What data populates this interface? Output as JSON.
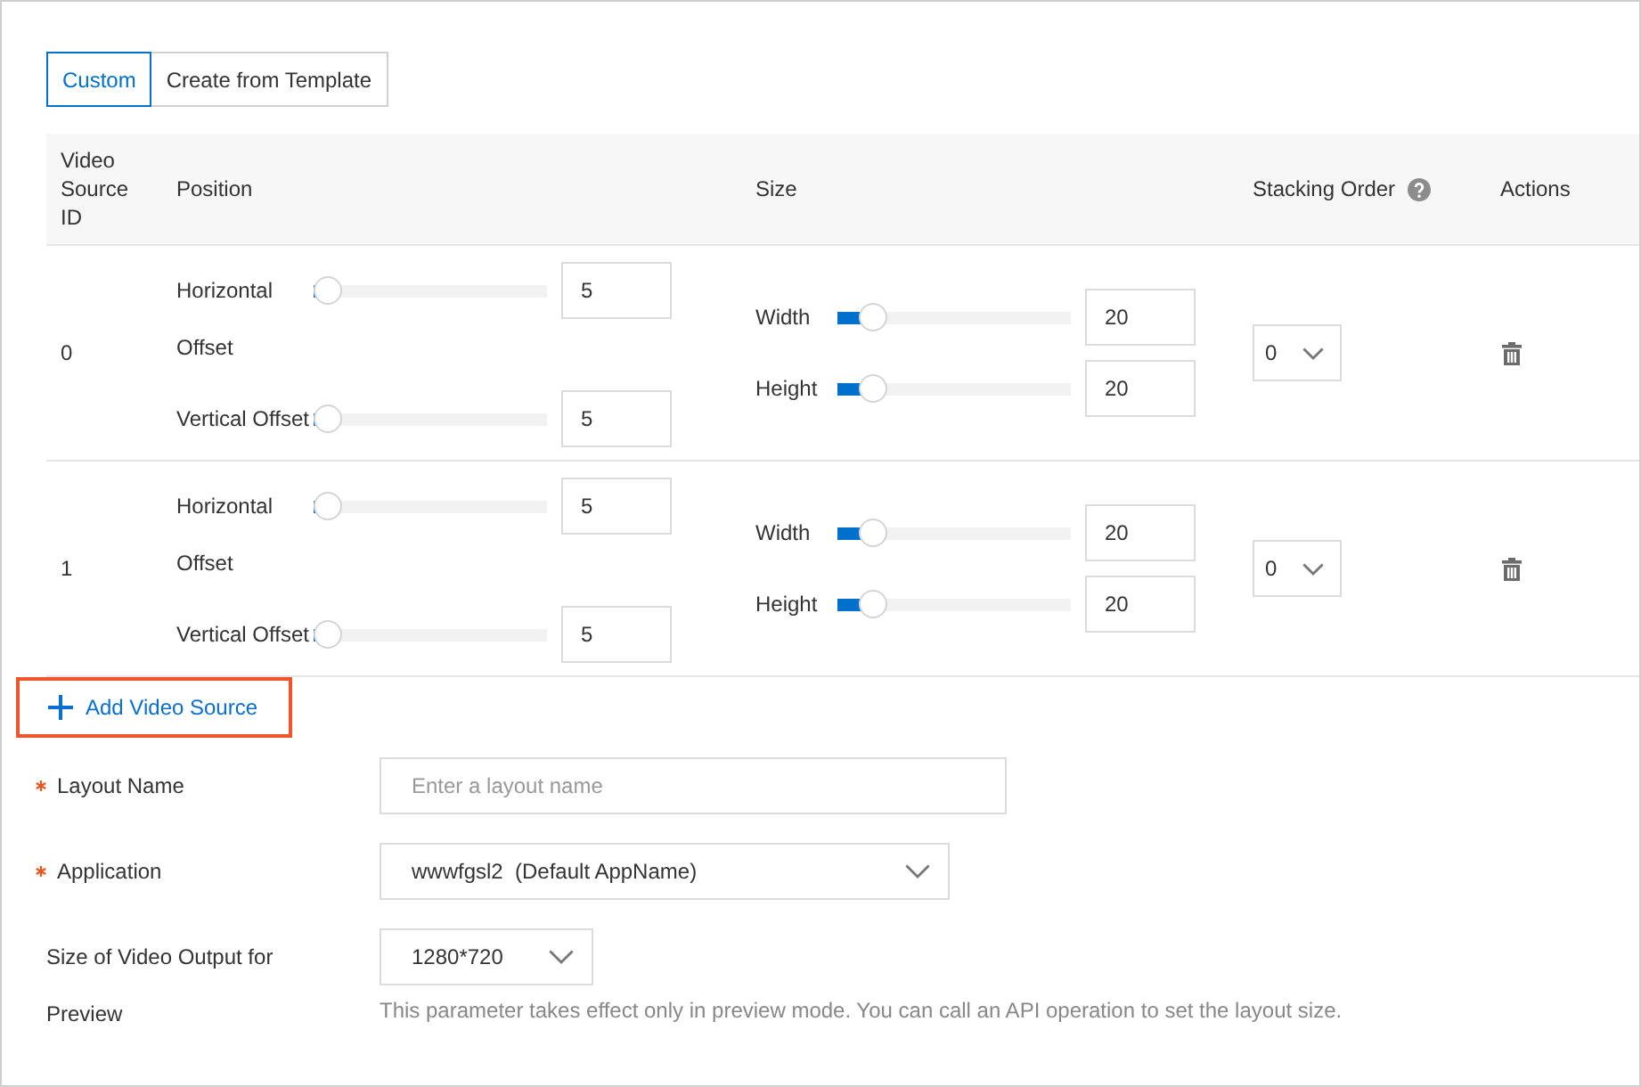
{
  "tabs": [
    {
      "label": "Custom",
      "selected": true
    },
    {
      "label": "Create from Template",
      "selected": false
    }
  ],
  "table": {
    "columns": [
      {
        "label": "Video Source ID",
        "help_icon": false
      },
      {
        "label": "Position",
        "help_icon": false
      },
      {
        "label": "Size",
        "help_icon": false
      },
      {
        "label": "Stacking Order",
        "help_icon": true
      },
      {
        "label": "Actions",
        "help_icon": false
      }
    ],
    "rows": [
      {
        "id": "0",
        "position": [
          {
            "label": "Horizontal Offset",
            "level": 0,
            "value": "5"
          },
          {
            "label": "Vertical Offset",
            "level": 0,
            "value": "5"
          }
        ],
        "size": [
          {
            "label": "Width",
            "level": 0.1,
            "value": "20"
          },
          {
            "label": "Height",
            "level": 0.1,
            "value": "20"
          }
        ],
        "stacking_order": "0"
      },
      {
        "id": "1",
        "position": [
          {
            "label": "Horizontal Offset",
            "level": 0,
            "value": "5"
          },
          {
            "label": "Vertical Offset",
            "level": 0,
            "value": "5"
          }
        ],
        "size": [
          {
            "label": "Width",
            "level": 0.1,
            "value": "20"
          },
          {
            "label": "Height",
            "level": 0.1,
            "value": "20"
          }
        ],
        "stacking_order": "0"
      }
    ]
  },
  "add_button": {
    "label": "Add Video Source",
    "highlighted": true
  },
  "form": {
    "fields": [
      {
        "kind": "input",
        "label": "Layout Name",
        "required": true,
        "placeholder": "Enter a layout name"
      },
      {
        "kind": "select",
        "label": "Application",
        "required": true,
        "value": "wwwfgsl2  (Default AppName)"
      },
      {
        "kind": "select",
        "label": "Size of Video Output for Preview",
        "required": false,
        "value": "1280*720",
        "help_text": "This parameter takes effect only in preview mode. You can call an API operation to set the layout size."
      }
    ]
  }
}
